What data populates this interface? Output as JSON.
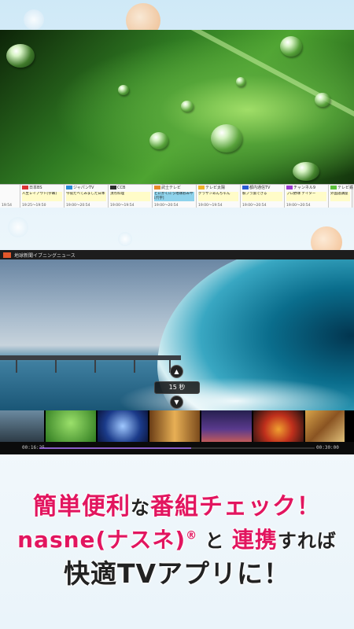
{
  "epg": {
    "channels": [
      {
        "name": "",
        "program": "",
        "time": "19:54"
      },
      {
        "name": "日本BS",
        "program": "人生レイアウト[字幕]",
        "time": "19:25～19:50"
      },
      {
        "name": "ジャパンTV",
        "program": "今夜たべてみました日本",
        "time": "19:00～20:54"
      },
      {
        "name": "CCB",
        "program": "頂点料理",
        "time": "19:00～19:54"
      },
      {
        "name": "武士テレビ",
        "program": "とにかくにう地球おみやげ[字]",
        "time": "19:00～20:54"
      },
      {
        "name": "テレビ太陽",
        "program": "グラサンあんちゃん",
        "time": "19:00～19:54"
      },
      {
        "name": "都内通信TV",
        "program": "駅ブラ旅できる",
        "time": "19:00～20:54"
      },
      {
        "name": "チャンネル9",
        "program": "プロ野球 ナイター",
        "time": "19:00～20:54"
      },
      {
        "name": "テレビ鉄",
        "program": "外国語講座",
        "time": ""
      }
    ]
  },
  "player": {
    "program_title": "地球新聞イブニングニュース",
    "seek_label": "15 秒",
    "elapsed": "00:16:25",
    "total": "00:30:00",
    "progress": 0.55
  },
  "caption": {
    "l1_a": "簡単便利",
    "l1_b": "な",
    "l1_c": "番組チェック！",
    "l2_a": "nasne(ナスネ)",
    "l2_reg": "®",
    "l2_b": "と",
    "l2_c": "連携",
    "l2_d": "すれば",
    "l3": "快適TVアプリに！"
  },
  "colors": {
    "accent": "#e2155f",
    "progress": "#8b5ec8"
  }
}
